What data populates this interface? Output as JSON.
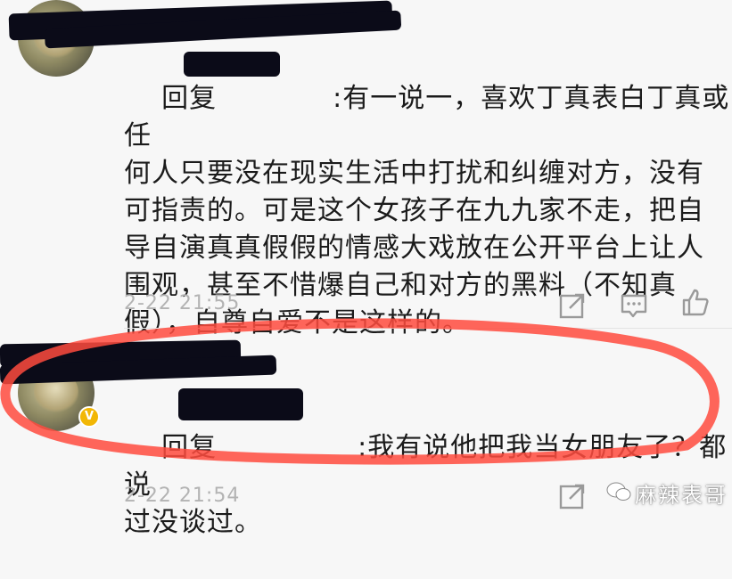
{
  "comments": [
    {
      "reply_prefix": "回复",
      "reply_after": ":有一说一，喜欢丁真表白丁真或任\n何人只要没在现实生活中打扰和纠缠对方，没有\n可指责的。可是这个女孩子在九九家不走，把自\n导自演真真假假的情感大戏放在公开平台上让人\n围观，甚至不惜爆自己和对方的黑料（不知真\n假），自尊自爱不是这样的。",
      "timestamp": "2-22 21:55"
    },
    {
      "reply_prefix": "回复",
      "reply_after": ":我有说他把我当女朋友了？都说\n过没谈过。",
      "timestamp": "2-22 21:54"
    }
  ],
  "icons": {
    "share": "share-icon",
    "comment": "comment-icon",
    "like": "thumbs-up-icon"
  },
  "watermark": {
    "text": "麻辣表哥"
  },
  "colors": {
    "annotation_red": "#ff4b3e"
  }
}
